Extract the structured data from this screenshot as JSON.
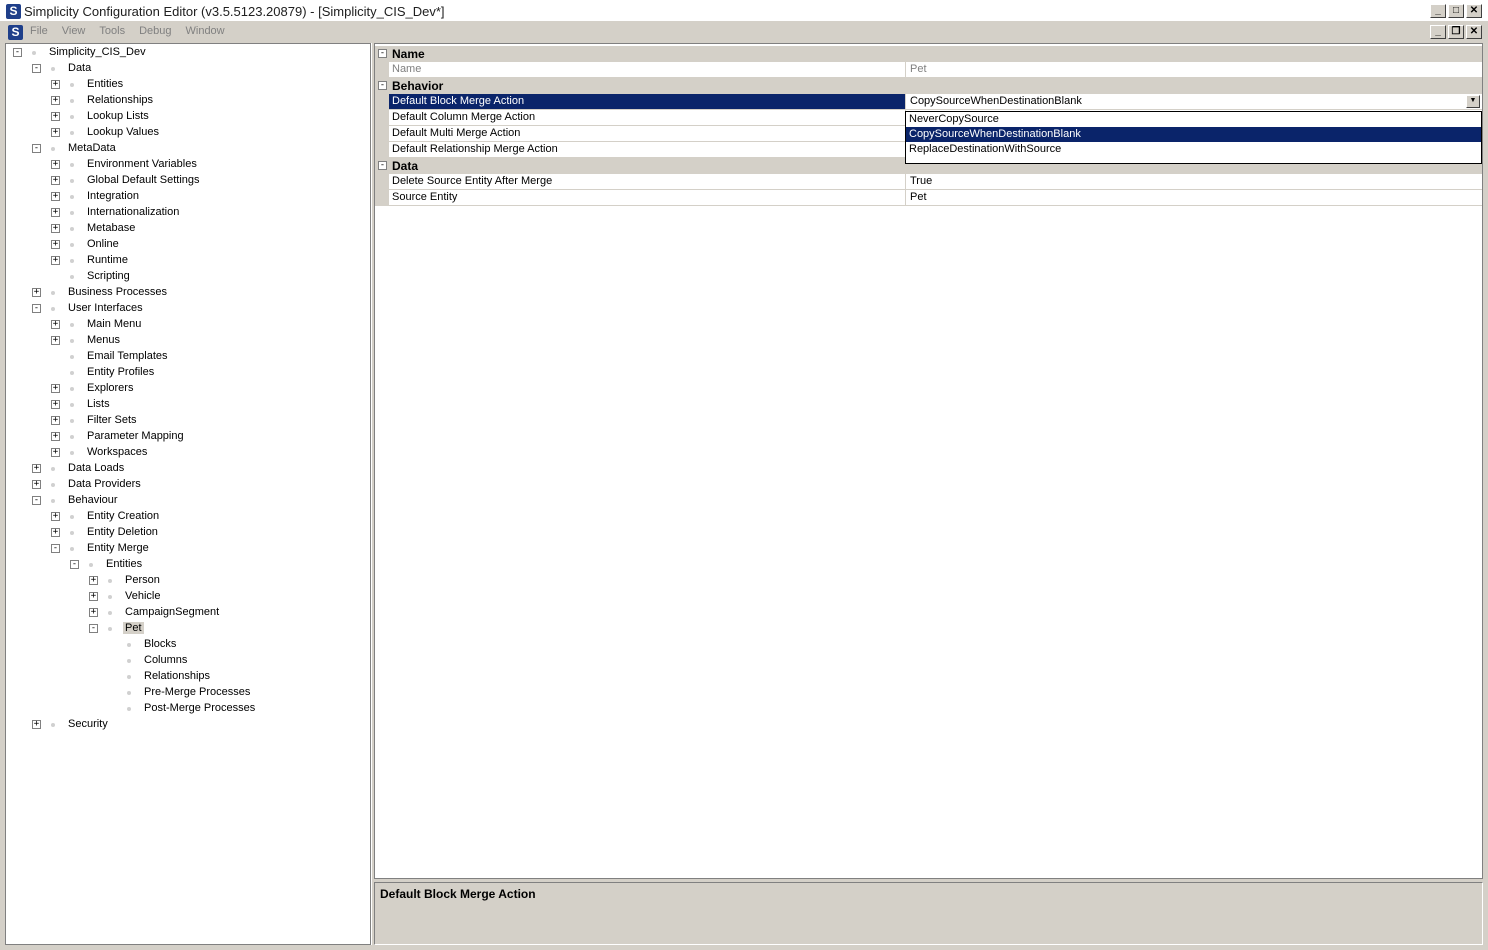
{
  "window": {
    "app_icon": "S",
    "title": "Simplicity Configuration Editor (v3.5.5123.20879) - [Simplicity_CIS_Dev*]",
    "controls": [
      "_",
      "□",
      "✕"
    ],
    "mdi_controls": [
      "_",
      "❐",
      "✕"
    ]
  },
  "menu": [
    "File",
    "View",
    "Tools",
    "Debug",
    "Window"
  ],
  "tree": [
    {
      "label": "Simplicity_CIS_Dev",
      "level": 0,
      "exp": "-"
    },
    {
      "label": "Data",
      "level": 1,
      "exp": "-"
    },
    {
      "label": "Entities",
      "level": 2,
      "exp": "+"
    },
    {
      "label": "Relationships",
      "level": 2,
      "exp": "+"
    },
    {
      "label": "Lookup Lists",
      "level": 2,
      "exp": "+"
    },
    {
      "label": "Lookup Values",
      "level": 2,
      "exp": "+"
    },
    {
      "label": "MetaData",
      "level": 1,
      "exp": "-"
    },
    {
      "label": "Environment Variables",
      "level": 2,
      "exp": "+"
    },
    {
      "label": "Global Default Settings",
      "level": 2,
      "exp": "+"
    },
    {
      "label": "Integration",
      "level": 2,
      "exp": "+"
    },
    {
      "label": "Internationalization",
      "level": 2,
      "exp": "+"
    },
    {
      "label": "Metabase",
      "level": 2,
      "exp": "+"
    },
    {
      "label": "Online",
      "level": 2,
      "exp": "+"
    },
    {
      "label": "Runtime",
      "level": 2,
      "exp": "+"
    },
    {
      "label": "Scripting",
      "level": 2,
      "exp": ""
    },
    {
      "label": "Business Processes",
      "level": 1,
      "exp": "+"
    },
    {
      "label": "User Interfaces",
      "level": 1,
      "exp": "-"
    },
    {
      "label": "Main Menu",
      "level": 2,
      "exp": "+"
    },
    {
      "label": "Menus",
      "level": 2,
      "exp": "+"
    },
    {
      "label": "Email Templates",
      "level": 2,
      "exp": ""
    },
    {
      "label": "Entity Profiles",
      "level": 2,
      "exp": ""
    },
    {
      "label": "Explorers",
      "level": 2,
      "exp": "+"
    },
    {
      "label": "Lists",
      "level": 2,
      "exp": "+"
    },
    {
      "label": "Filter Sets",
      "level": 2,
      "exp": "+"
    },
    {
      "label": "Parameter Mapping",
      "level": 2,
      "exp": "+"
    },
    {
      "label": "Workspaces",
      "level": 2,
      "exp": "+"
    },
    {
      "label": "Data Loads",
      "level": 1,
      "exp": "+"
    },
    {
      "label": "Data Providers",
      "level": 1,
      "exp": "+"
    },
    {
      "label": "Behaviour",
      "level": 1,
      "exp": "-"
    },
    {
      "label": "Entity Creation",
      "level": 2,
      "exp": "+"
    },
    {
      "label": "Entity Deletion",
      "level": 2,
      "exp": "+"
    },
    {
      "label": "Entity Merge",
      "level": 2,
      "exp": "-"
    },
    {
      "label": "Entities",
      "level": 3,
      "exp": "-"
    },
    {
      "label": "Person",
      "level": 4,
      "exp": "+"
    },
    {
      "label": "Vehicle",
      "level": 4,
      "exp": "+"
    },
    {
      "label": "CampaignSegment",
      "level": 4,
      "exp": "+"
    },
    {
      "label": "Pet",
      "level": 4,
      "exp": "-",
      "selected": true
    },
    {
      "label": "Blocks",
      "level": 5,
      "exp": ""
    },
    {
      "label": "Columns",
      "level": 5,
      "exp": ""
    },
    {
      "label": "Relationships",
      "level": 5,
      "exp": ""
    },
    {
      "label": "Pre-Merge Processes",
      "level": 5,
      "exp": ""
    },
    {
      "label": "Post-Merge Processes",
      "level": 5,
      "exp": ""
    },
    {
      "label": "Security",
      "level": 1,
      "exp": "+"
    }
  ],
  "grid": [
    {
      "type": "cat",
      "label": "Name",
      "exp": "-"
    },
    {
      "type": "prop",
      "name": "Name",
      "value": "Pet",
      "disabled": true
    },
    {
      "type": "cat",
      "label": "Behavior",
      "exp": "-"
    },
    {
      "type": "prop",
      "name": "Default Block Merge Action",
      "value": "CopySourceWhenDestinationBlank",
      "selected": true,
      "dropdown": "▼"
    },
    {
      "type": "prop",
      "name": "Default Column Merge Action",
      "value": ""
    },
    {
      "type": "prop",
      "name": "Default Multi Merge Action",
      "value": ""
    },
    {
      "type": "prop",
      "name": "Default Relationship Merge Action",
      "value": ""
    },
    {
      "type": "cat",
      "label": "Data",
      "exp": "-"
    },
    {
      "type": "prop",
      "name": "Delete Source Entity After Merge",
      "value": "True"
    },
    {
      "type": "prop",
      "name": "Source Entity",
      "value": "Pet"
    }
  ],
  "dropdown": {
    "options": [
      "NeverCopySource",
      "CopySourceWhenDestinationBlank",
      "ReplaceDestinationWithSource"
    ],
    "selected_index": 1
  },
  "description": {
    "title": "Default Block Merge Action"
  }
}
